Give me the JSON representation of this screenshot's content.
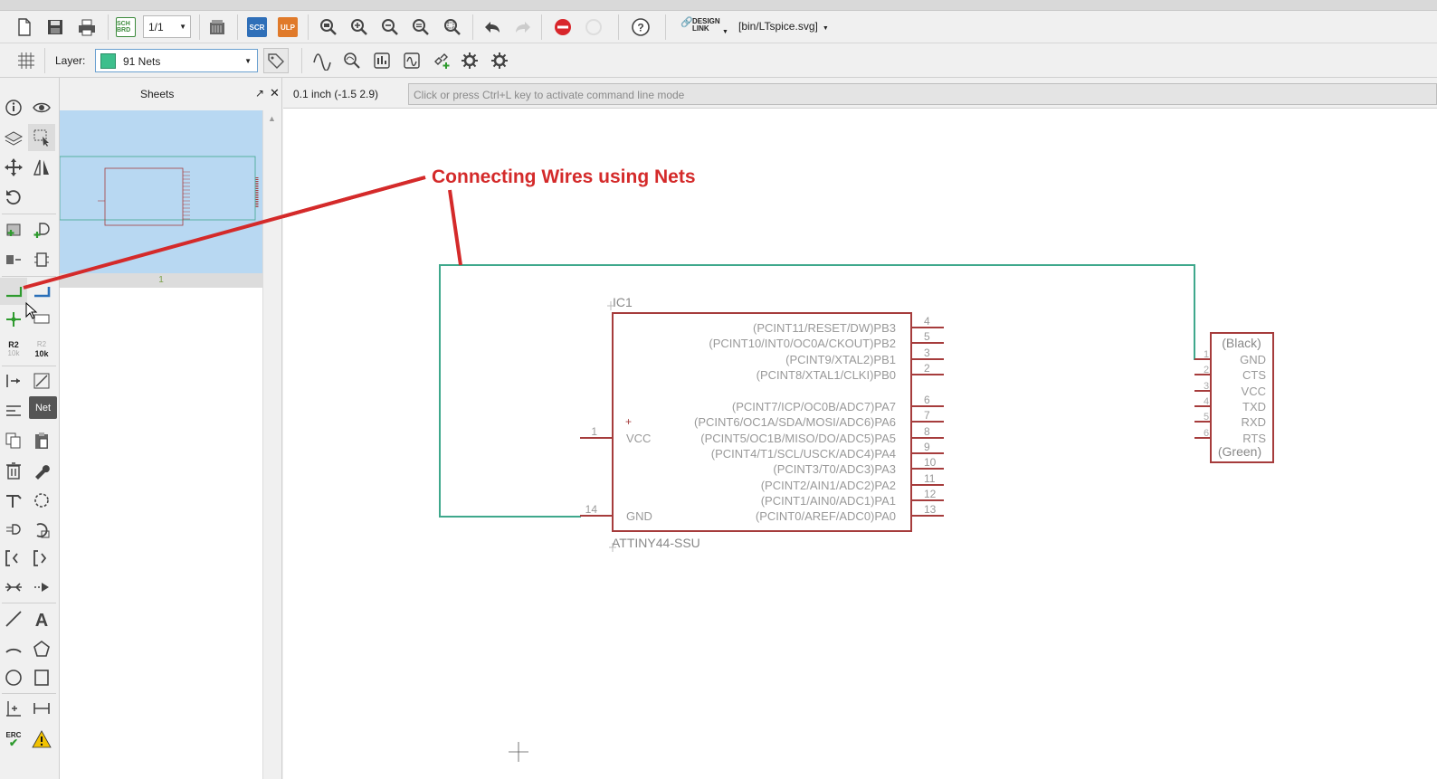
{
  "toolbar": {
    "sheet_selector": "1/1",
    "sch_brd_label": "SCH BRD",
    "scr_label": "SCR",
    "ulp_label": "ULP",
    "design_link_label": "DESIGN LINK",
    "file_path": "[bin/LTspice.svg]"
  },
  "toolbar2": {
    "layer_label": "Layer:",
    "layer_value": "91 Nets",
    "layer_color": "#3dbf8c"
  },
  "left_tools": {
    "tooltip": "Net",
    "value_label_r2": "R2",
    "value_label_10k": "10k",
    "erc_label": "ERC"
  },
  "sheets_panel": {
    "title": "Sheets",
    "thumb_number": "1"
  },
  "status": {
    "coordinates": "0.1 inch (-1.5 2.9)",
    "command_placeholder": "Click or press Ctrl+L key to activate command line mode"
  },
  "annotation": {
    "text": "Connecting Wires using Nets",
    "color": "#d42a2a"
  },
  "schematic": {
    "net_color": "#3fa88c",
    "part_color": "#a63c3c",
    "ic": {
      "name": "IC1",
      "value": "ATTINY44-SSU",
      "left_pins": [
        {
          "num": "1",
          "label": "VCC"
        },
        {
          "num": "14",
          "label": "GND"
        }
      ],
      "right_pins": [
        {
          "num": "4",
          "label": "(PCINT11/RESET/DW)PB3"
        },
        {
          "num": "5",
          "label": "(PCINT10/INT0/OC0A/CKOUT)PB2"
        },
        {
          "num": "3",
          "label": "(PCINT9/XTAL2)PB1"
        },
        {
          "num": "2",
          "label": "(PCINT8/XTAL1/CLKI)PB0"
        },
        {
          "num": "6",
          "label": "(PCINT7/ICP/OC0B/ADC7)PA7"
        },
        {
          "num": "7",
          "label": "(PCINT6/OC1A/SDA/MOSI/ADC6)PA6"
        },
        {
          "num": "8",
          "label": "(PCINT5/OC1B/MISO/DO/ADC5)PA5"
        },
        {
          "num": "9",
          "label": "(PCINT4/T1/SCL/USCK/ADC4)PA4"
        },
        {
          "num": "10",
          "label": "(PCINT3/T0/ADC3)PA3"
        },
        {
          "num": "11",
          "label": "(PCINT2/AIN1/ADC2)PA2"
        },
        {
          "num": "12",
          "label": "(PCINT1/AIN0/ADC1)PA1"
        },
        {
          "num": "13",
          "label": "(PCINT0/AREF/ADC0)PA0"
        }
      ]
    },
    "connector": {
      "top_label": "(Black)",
      "bottom_label": "(Green)",
      "pins": [
        {
          "num": "1",
          "label": "GND"
        },
        {
          "num": "2",
          "label": "CTS"
        },
        {
          "num": "3",
          "label": "VCC"
        },
        {
          "num": "4",
          "label": "TXD"
        },
        {
          "num": "5",
          "label": "RXD"
        },
        {
          "num": "6",
          "label": "RTS"
        }
      ]
    }
  }
}
